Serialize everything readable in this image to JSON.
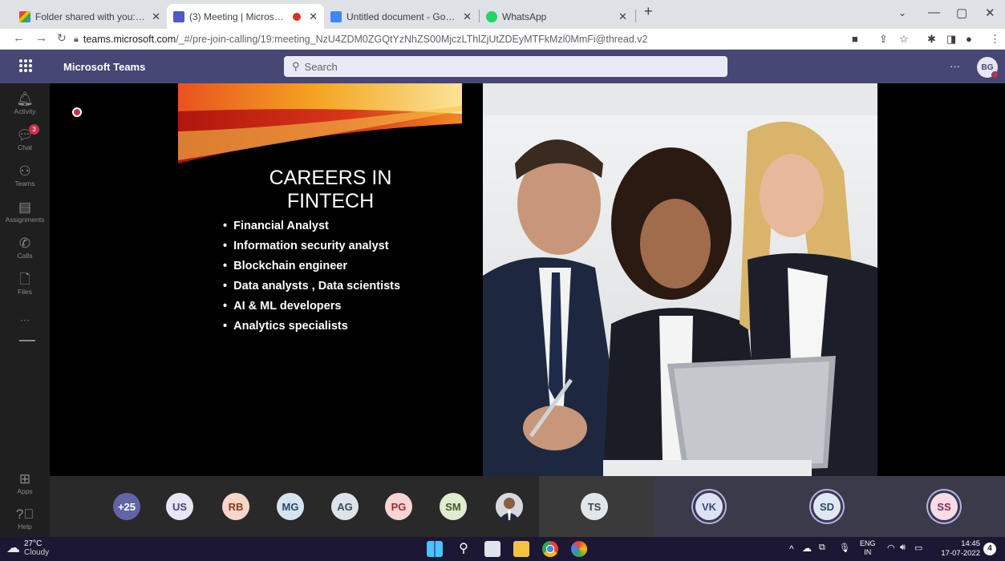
{
  "browser": {
    "tabs": [
      {
        "title": "Folder shared with you: \"Referen",
        "icon": "gmail-icon",
        "active": false
      },
      {
        "title": "(3) Meeting | Microsoft Team",
        "icon": "teams-icon",
        "active": true
      },
      {
        "title": "Untitled document - Google Doc",
        "icon": "google-docs-icon",
        "active": false
      },
      {
        "title": "WhatsApp",
        "icon": "whatsapp-icon",
        "active": false
      }
    ],
    "url_host": "teams.microsoft.com",
    "url_path": "/_#/pre-join-calling/19:meeting_NzU4ZDM0ZGQtYzNhZS00MjczLThlZjUtZDEyMTFkMzl0MmFi@thread.v2"
  },
  "teams": {
    "app_name": "Microsoft Teams",
    "search_placeholder": "Search",
    "more": "···",
    "user_initials": "BG",
    "rail": [
      {
        "label": "Activity",
        "icon": "bell-icon"
      },
      {
        "label": "Chat",
        "icon": "chat-icon",
        "badge": "3"
      },
      {
        "label": "Teams",
        "icon": "teams-icon"
      },
      {
        "label": "Assignments",
        "icon": "assignments-icon"
      },
      {
        "label": "Calls",
        "icon": "phone-icon"
      },
      {
        "label": "Files",
        "icon": "file-icon"
      }
    ],
    "rail_more": "···",
    "rail_bottom": [
      {
        "label": "Apps",
        "icon": "apps-icon"
      },
      {
        "label": "Help",
        "icon": "help-icon"
      }
    ]
  },
  "slide": {
    "title_line1": "CAREERS IN",
    "title_line2": "FINTECH",
    "bullets": [
      "Financial Analyst",
      "Information security analyst",
      "Blockchain engineer",
      "Data analysts , Data scientists",
      "AI & ML developers",
      "Analytics specialists"
    ]
  },
  "participants": [
    {
      "initials": "+25",
      "bg": "#6264a7",
      "fg": "#ffffff"
    },
    {
      "initials": "US",
      "bg": "#e8e6f2",
      "fg": "#464775"
    },
    {
      "initials": "RB",
      "bg": "#f6d6c8",
      "fg": "#8a3b1e"
    },
    {
      "initials": "MG",
      "bg": "#d6e3f0",
      "fg": "#2b4a6b"
    },
    {
      "initials": "AG",
      "bg": "#dde3e8",
      "fg": "#3a4b58"
    },
    {
      "initials": "PG",
      "bg": "#f7d5d5",
      "fg": "#9b2d2d"
    },
    {
      "initials": "SM",
      "bg": "#dfeccf",
      "fg": "#3f5a22"
    },
    {
      "initials": "",
      "bg": "#d8d8d8",
      "fg": "#333333",
      "photo": true
    },
    {
      "initials": "TS",
      "bg": "#e0e6ea",
      "fg": "#3b4852"
    },
    {
      "initials": "VK",
      "bg": "#dde3f5",
      "fg": "#3b4a7a"
    },
    {
      "initials": "SD",
      "bg": "#dfe8f3",
      "fg": "#2e4a66"
    },
    {
      "initials": "SS",
      "bg": "#f7dce8",
      "fg": "#8a2a55"
    }
  ],
  "taskbar": {
    "weather_temp": "27°C",
    "weather_desc": "Cloudy",
    "lang1": "ENG",
    "lang2": "IN",
    "time": "14:45",
    "date": "17-07-2022",
    "notif_count": "4"
  }
}
